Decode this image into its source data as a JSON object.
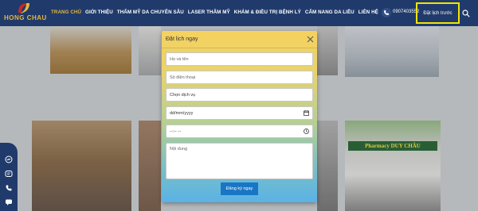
{
  "header": {
    "logo_text": "HONG CHAU",
    "logo_sub": "",
    "nav": [
      {
        "label": "TRANG CHỦ",
        "active": true
      },
      {
        "label": "GIỚI THIỆU",
        "active": false
      },
      {
        "label": "THẨM MỸ DA CHUYÊN SÂU",
        "active": false
      },
      {
        "label": "LASER THẨM MỸ",
        "active": false
      },
      {
        "label": "KHÁM & ĐIỀU TRỊ BỆNH LÝ",
        "active": false
      },
      {
        "label": "CẨM NANG DA LIỄU",
        "active": false
      },
      {
        "label": "LIÊN HỆ",
        "active": false
      }
    ],
    "phone": "0907403552",
    "book_label": "Đặt lịch trước"
  },
  "colors": {
    "header_bg": "#203b6b",
    "accent_gold": "#e8b63b",
    "highlight_border": "#f5e500",
    "submit_blue": "#1976c6"
  },
  "modal": {
    "title": "Đặt lịch ngay",
    "fields": {
      "name_placeholder": "Họ và tên",
      "phone_placeholder": "Số điện thoại",
      "service_value": "Chọn dịch vụ",
      "date_value": "dd/mm/yyyy",
      "time_value": "--:-- --",
      "content_placeholder": "Nội dung"
    },
    "submit_label": "Đăng ký ngay"
  },
  "background": {
    "pharmacy_sign": "Pharmacy DUY CHÂU"
  },
  "icons": [
    "logo-mark-icon",
    "phone-icon",
    "search-icon",
    "close-icon",
    "calendar-icon",
    "clock-icon",
    "messenger-icon",
    "zalo-icon",
    "phone-call-icon",
    "chat-icon"
  ]
}
